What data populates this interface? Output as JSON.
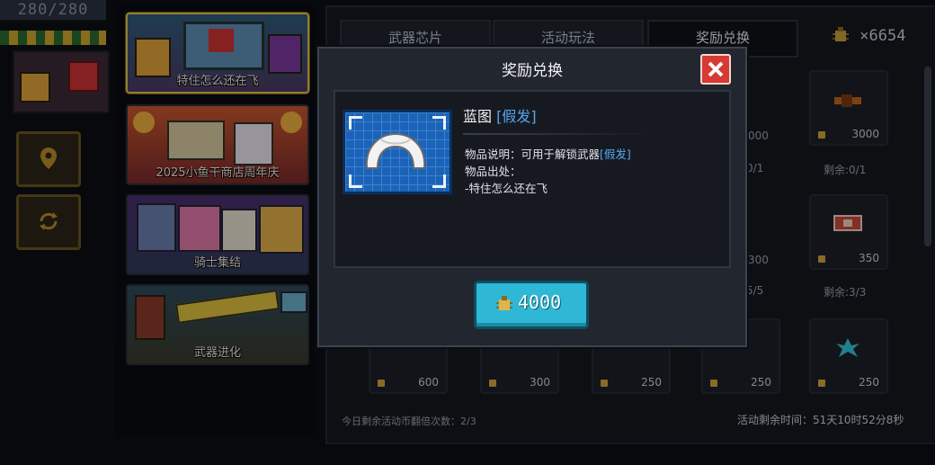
{
  "hud": {
    "hp_text": "280/280"
  },
  "events": [
    {
      "label": "特住怎么还在飞",
      "active": true
    },
    {
      "label": "2025小鱼干商店周年庆",
      "active": false
    },
    {
      "label": "骑士集结",
      "active": false
    },
    {
      "label": "武器进化",
      "active": false
    }
  ],
  "shop": {
    "tabs": [
      {
        "label": "武器芯片",
        "active": false
      },
      {
        "label": "活动玩法",
        "active": false
      },
      {
        "label": "奖励兑换",
        "active": true
      }
    ],
    "currency": "×6654",
    "items": [
      {
        "price": "3000",
        "remain": "剩余:0/1"
      },
      {
        "price": "350",
        "remain": "剩余:3/3"
      },
      {
        "price": "600"
      },
      {
        "price": "300"
      },
      {
        "price": "250"
      },
      {
        "price": "250"
      },
      {
        "price": "250"
      }
    ],
    "partial_prices": {
      "row1": "000",
      "row2": "300"
    },
    "partial_remain": {
      "row1": "0/1",
      "row2": "5/5"
    },
    "daily_flip": "今日剩余活动币翻倍次数：2/3",
    "event_time": "活动剩余时间：51天10时52分8秒"
  },
  "modal": {
    "title": "奖励兑换",
    "item_name": "蓝图",
    "item_tag": "[假发]",
    "desc_label": "物品说明：可用于解锁武器",
    "desc_tag": "[假发]",
    "source_label": "物品出处：",
    "source_value": "-特住怎么还在飞",
    "price": "4000"
  },
  "colors": {
    "accent": "#2eb8d6",
    "close": "#d63a32",
    "gold": "#e2c14a",
    "link": "#55a7f2"
  }
}
